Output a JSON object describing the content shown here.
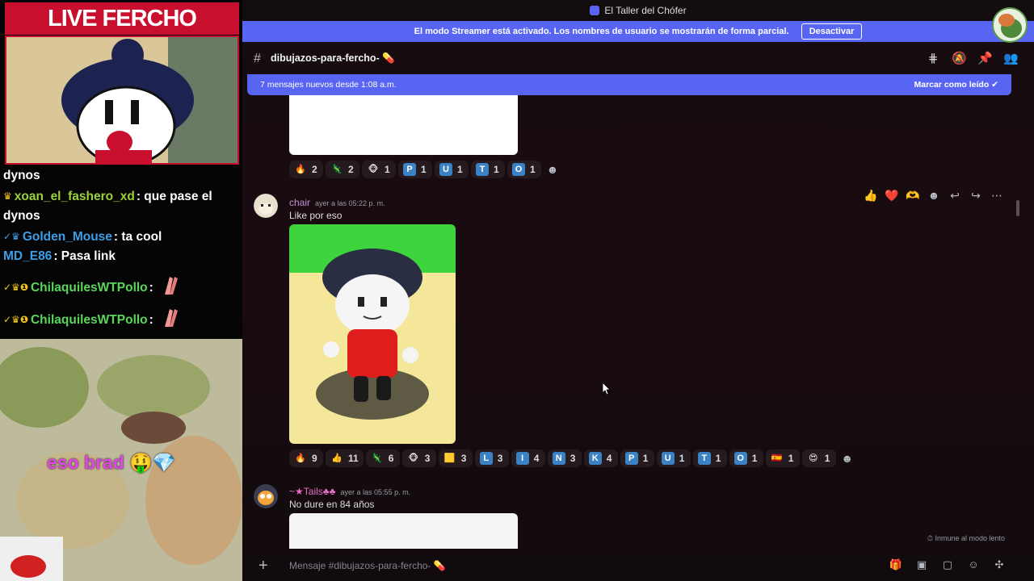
{
  "stream": {
    "title": "LIVE FERCHO REACTION",
    "chat": [
      {
        "user": "",
        "text": "dynos",
        "user_color": "#ffffff",
        "badges": ""
      },
      {
        "user": "xoan_el_fashero_xd",
        "text": ": que pase el dynos",
        "user_color": "#9bd23c",
        "badges": "♛"
      },
      {
        "user": "Golden_Mouse",
        "text": ": ta cool",
        "user_color": "#3d9ee8",
        "badges": "✓♛"
      },
      {
        "user": "MD_E86",
        "text": ": Pasa link",
        "user_color": "#3d9ee8",
        "badges": ""
      },
      {
        "user": "ChilaquilesWTPollo",
        "text": ":",
        "user_color": "#5bd65b",
        "badges": "✓♛❶"
      },
      {
        "user": "ChilaquilesWTPollo",
        "text": ":",
        "user_color": "#5bd65b",
        "badges": "✓♛❶"
      }
    ],
    "meme_caption": "eso brad"
  },
  "window": {
    "title": "El Taller del Chófer"
  },
  "streamer_bar": {
    "text": "El modo Streamer está activado. Los nombres de usuario se mostrarán de forma parcial.",
    "button": "Desactivar"
  },
  "channel": {
    "name": "dibujazos-para-fercho-",
    "header_icons": [
      "threads-icon",
      "mute-icon",
      "pin-icon",
      "members-icon"
    ]
  },
  "new_messages_bar": {
    "text": "7 mensajes nuevos desde 1:08 a.m.",
    "action": "Marcar como leído"
  },
  "messages": [
    {
      "reactions": [
        {
          "emoji": "🔥",
          "count": "2"
        },
        {
          "emoji": "🦎",
          "count": "2"
        },
        {
          "emoji": "🐵",
          "count": "1"
        },
        {
          "emoji": "P",
          "count": "1",
          "tile": true
        },
        {
          "emoji": "U",
          "count": "1",
          "tile": true
        },
        {
          "emoji": "T",
          "count": "1",
          "tile": true
        },
        {
          "emoji": "O",
          "count": "1",
          "tile": true
        }
      ]
    },
    {
      "author": "chair",
      "author_color": "#c58ed4",
      "time": "ayer a las 05:22 p. m.",
      "text": "Like por eso",
      "reactions": [
        {
          "emoji": "🔥",
          "count": "9"
        },
        {
          "emoji": "👍",
          "count": "11"
        },
        {
          "emoji": "🦎",
          "count": "6"
        },
        {
          "emoji": "🐵",
          "count": "3"
        },
        {
          "emoji": "🟨",
          "count": "3"
        },
        {
          "emoji": "L",
          "count": "3",
          "tile": true
        },
        {
          "emoji": "I",
          "count": "4",
          "tile": true
        },
        {
          "emoji": "N",
          "count": "3",
          "tile": true
        },
        {
          "emoji": "K",
          "count": "4",
          "tile": true
        },
        {
          "emoji": "P",
          "count": "1",
          "tile": true
        },
        {
          "emoji": "U",
          "count": "1",
          "tile": true
        },
        {
          "emoji": "T",
          "count": "1",
          "tile": true
        },
        {
          "emoji": "O",
          "count": "1",
          "tile": true
        },
        {
          "emoji": "🇪🇸",
          "count": "1"
        },
        {
          "emoji": "😍",
          "count": "1"
        }
      ]
    },
    {
      "author": "~★Tails♣♣",
      "author_color": "#e56fc8",
      "time": "ayer a las 05:55 p. m.",
      "text": "No dure en 84 años"
    }
  ],
  "hover_actions": [
    "👍",
    "❤️",
    "🫶",
    "☻",
    "↩",
    "↪",
    "⋯"
  ],
  "slowmode": "Inmune al modo lento",
  "composer": {
    "placeholder": "Mensaje #dibujazos-para-fercho-"
  },
  "colors": {
    "blurple": "#5865f2",
    "live_red": "#c8102e"
  }
}
